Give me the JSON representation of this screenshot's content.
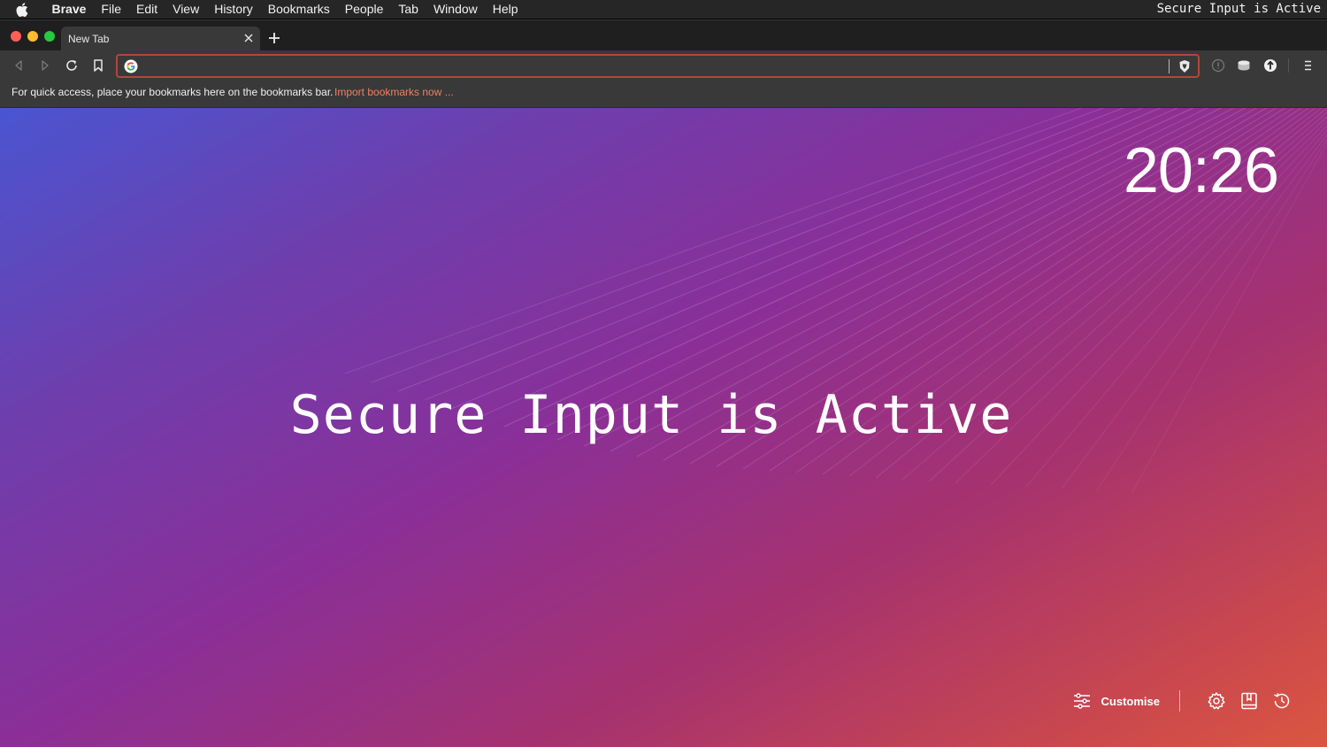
{
  "menubar": {
    "items": [
      "Brave",
      "File",
      "Edit",
      "View",
      "History",
      "Bookmarks",
      "People",
      "Tab",
      "Window",
      "Help"
    ],
    "status_text": "Secure Input is Active"
  },
  "tabs": [
    {
      "title": "New Tab",
      "active": true
    }
  ],
  "omnibox": {
    "value": "",
    "placeholder": "",
    "focus_ring_color": "#b5453a"
  },
  "bookmarks_bar": {
    "hint": "For quick access, place your bookmarks here on the bookmarks bar.",
    "import_link": "Import bookmarks now ..."
  },
  "new_tab_page": {
    "clock": "20:26",
    "overlay_text": "Secure Input is Active",
    "customise_label": "Customise",
    "footer_icons": [
      "settings-icon",
      "bookmarks-icon",
      "history-icon"
    ]
  },
  "colors": {
    "accent_link": "#f07f60",
    "gradient_start": "#4a55d1",
    "gradient_end": "#db5640"
  }
}
